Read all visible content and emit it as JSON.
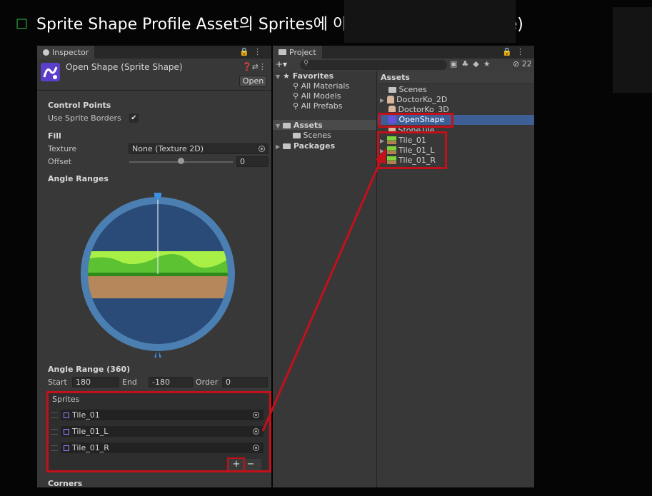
{
  "slide": {
    "bullet": "□",
    "title": "Sprite Shape Profile Asset의 Sprites에 이미지 등록 (Open Shape)"
  },
  "inspector": {
    "tab_label": "Inspector",
    "object_title": "Open Shape (Sprite Shape)",
    "open_button": "Open",
    "control_points_header": "Control Points",
    "use_sprite_borders_label": "Use Sprite Borders",
    "use_sprite_borders_checked": true,
    "fill_header": "Fill",
    "texture_label": "Texture",
    "texture_value": "None (Texture 2D)",
    "offset_label": "Offset",
    "offset_value": "0",
    "offset_slider_fraction": 0.5,
    "angle_ranges_header": "Angle Ranges",
    "angle_range_header": "Angle Range (360)",
    "start_label": "Start",
    "start_value": "180",
    "end_label": "End",
    "end_value": "-180",
    "order_label": "Order",
    "order_value": "0",
    "sprites_header": "Sprites",
    "sprites": [
      "Tile_01",
      "Tile_01_L",
      "Tile_01_R"
    ],
    "add_button": "+",
    "remove_button": "−",
    "corners_header": "Corners"
  },
  "project": {
    "tab_label": "Project",
    "add_button": "+▾",
    "search_placeholder": "",
    "hidden_count": "22",
    "favorites_label": "Favorites",
    "favorites": [
      "All Materials",
      "All Models",
      "All Prefabs"
    ],
    "assets_label": "Assets",
    "assets_children": [
      "Scenes"
    ],
    "packages_label": "Packages",
    "breadcrumb": "Assets",
    "files": [
      {
        "name": "Scenes",
        "kind": "folder"
      },
      {
        "name": "DoctorKo_2D",
        "kind": "character"
      },
      {
        "name": "DoctorKo_3D",
        "kind": "character"
      },
      {
        "name": "OpenShape",
        "kind": "spriteshape",
        "selected": true
      },
      {
        "name": "StoneTile",
        "kind": "character"
      },
      {
        "name": "Tile_01",
        "kind": "tile"
      },
      {
        "name": "Tile_01_L",
        "kind": "tile"
      },
      {
        "name": "Tile_01_R",
        "kind": "tile"
      }
    ]
  },
  "colors": {
    "highlight_red": "#c4101a",
    "selection_blue": "#3e5f96",
    "bullet_green": "#2fbf4a"
  }
}
